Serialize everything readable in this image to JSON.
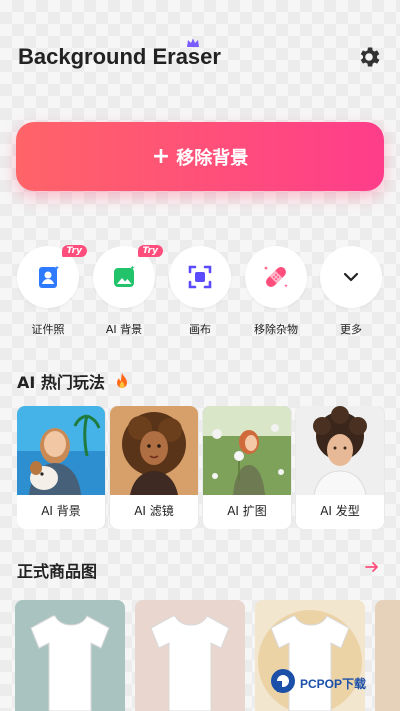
{
  "header": {
    "title": "Background Eraser",
    "crown_icon": "crown-icon",
    "settings_icon": "gear-icon"
  },
  "hero": {
    "label": "移除背景",
    "plus": "+"
  },
  "tools": [
    {
      "label": "证件照",
      "badge": "Try",
      "icon": "id-photo-icon",
      "color": "#2f7bff"
    },
    {
      "label": "AI 背景",
      "badge": "Try",
      "icon": "image-sparkle-icon",
      "color": "#22c36b"
    },
    {
      "label": "画布",
      "badge": "",
      "icon": "canvas-icon",
      "color": "#5a4bff"
    },
    {
      "label": "移除杂物",
      "badge": "",
      "icon": "bandage-icon",
      "color": "#ff4d7c"
    },
    {
      "label": "更多",
      "badge": "",
      "icon": "chevron-down-icon",
      "color": "#222222"
    }
  ],
  "ai_section": {
    "title": "AI 热门玩法",
    "fire_icon": "fire-icon",
    "cards": [
      {
        "label": "AI 背景"
      },
      {
        "label": "AI 滤镜"
      },
      {
        "label": "AI 扩图"
      },
      {
        "label": "AI 发型"
      }
    ]
  },
  "products": {
    "title": "正式商品图",
    "arrow_icon": "arrow-right-icon",
    "accent": "#ff4d7c",
    "items": [
      {
        "bg": "#a9c3c1"
      },
      {
        "bg": "#e9d7cf"
      },
      {
        "bg": "#f3e6cf"
      },
      {
        "bg": "#e6d2bb"
      }
    ]
  },
  "watermark": {
    "text": "PCPOP下载"
  }
}
